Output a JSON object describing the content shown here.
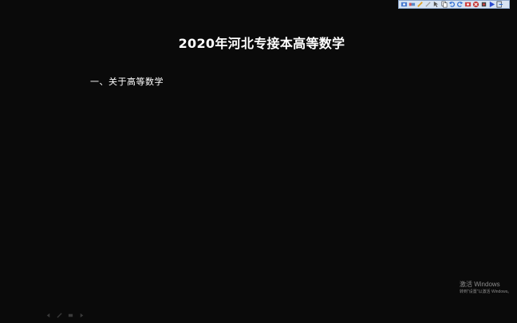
{
  "slide": {
    "title": "2020年河北专接本高等数学",
    "heading": "一、关于高等数学"
  },
  "watermark": {
    "title": "激活 Windows",
    "subtitle": "转到\"设置\"以激活 Windows。"
  },
  "toolbar": {
    "icons": [
      "photo-icon",
      "eraser-icon",
      "pen-icon",
      "highlighter-icon",
      "pointer-icon",
      "copy-icon",
      "undo-icon",
      "redo-icon",
      "capture-icon",
      "clear-icon",
      "record-icon",
      "play-icon",
      "exit-icon"
    ]
  },
  "bottom_controls": {
    "icons": [
      "prev-arrow-icon",
      "pen-tool-icon",
      "slides-icon",
      "next-arrow-icon"
    ]
  },
  "colors": {
    "background": "#0a0a0a",
    "text": "#ffffff",
    "toolbar_bg": "#d8e4f3",
    "watermark": "#8c8c8c"
  }
}
